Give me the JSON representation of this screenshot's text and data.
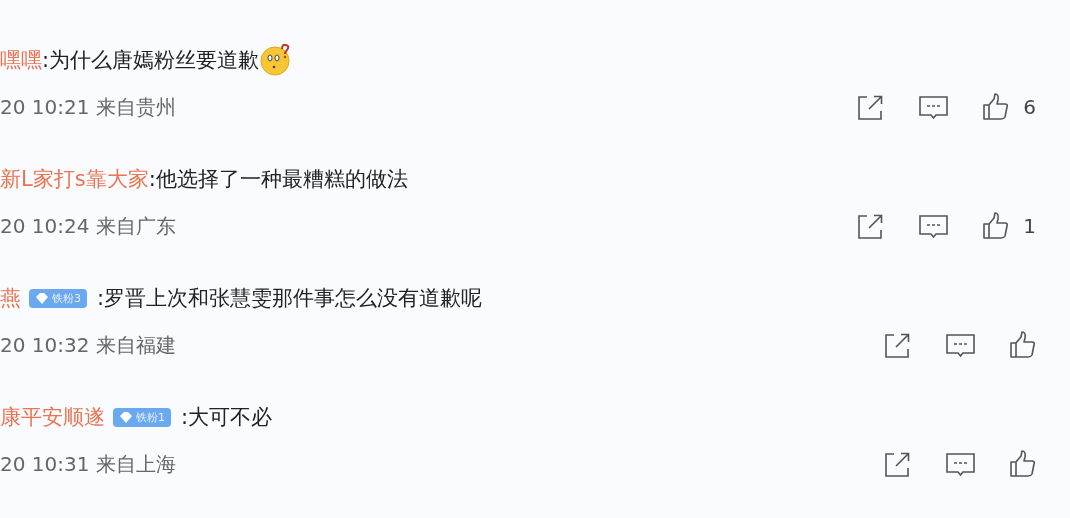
{
  "comments": [
    {
      "user": "嘿嘿",
      "text": ":为什么唐嫣粉丝要道歉",
      "emoji": true,
      "time": "20 10:21 来自贵州",
      "likes": "6"
    },
    {
      "user": "新L家打s靠大家",
      "text": ":他选择了一种最糟糕的做法",
      "emoji": false,
      "time": "20 10:24 来自广东",
      "likes": "1"
    },
    {
      "user": "燕",
      "badge": "铁粉3",
      "text": ":罗晋上次和张慧雯那件事怎么没有道歉呢",
      "emoji": false,
      "time": "20 10:32 来自福建"
    },
    {
      "user": "康平安顺遂",
      "badge": "铁粉1",
      "text": ":大可不必",
      "emoji": false,
      "time": "20 10:31 来自上海"
    }
  ]
}
